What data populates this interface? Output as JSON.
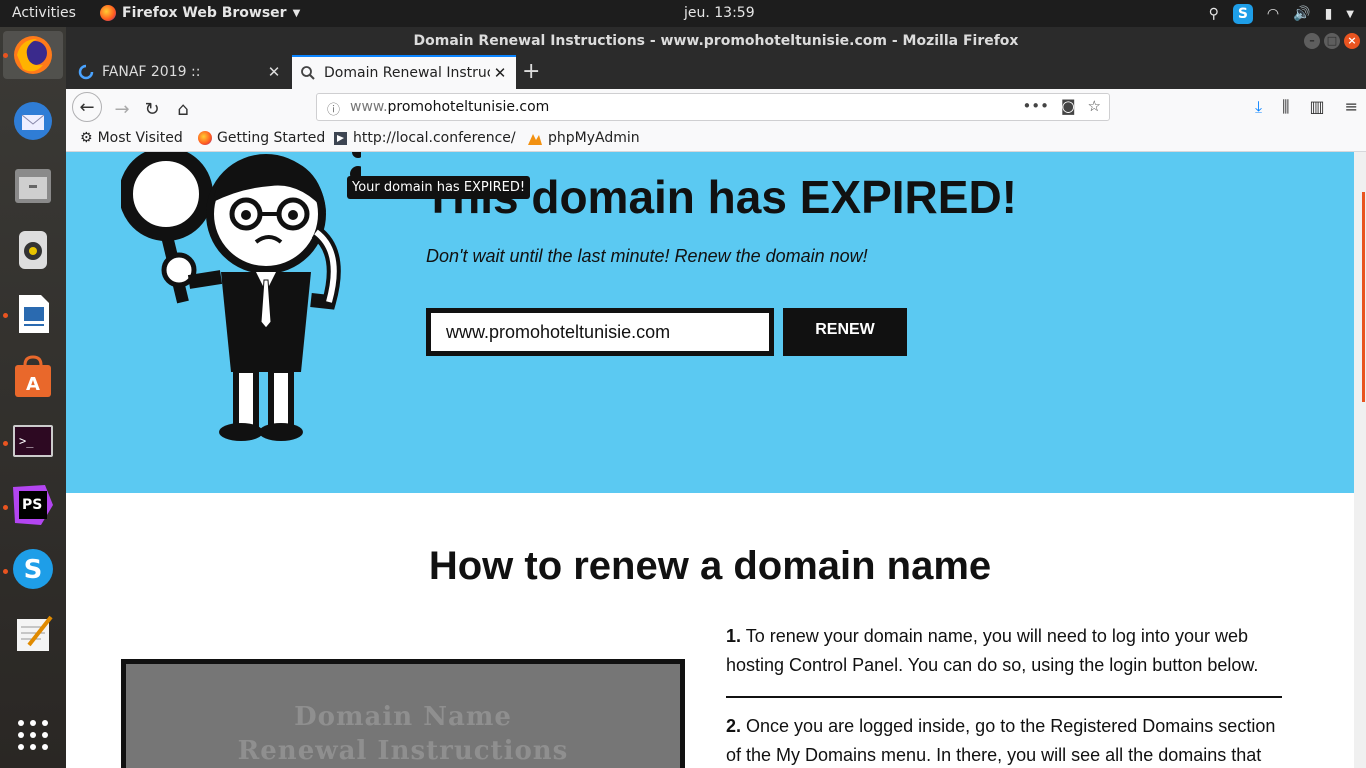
{
  "topbar": {
    "activities": "Activities",
    "app_name": "Firefox Web Browser",
    "clock": "jeu. 13:59"
  },
  "window": {
    "title": "Domain Renewal Instructions - www.promohoteltunisie.com - Mozilla Firefox"
  },
  "tabs": [
    {
      "label": "FANAF 2019 ::"
    },
    {
      "label": "Domain Renewal Instruct"
    }
  ],
  "urlbar": {
    "prefix": "www.",
    "domain": "promohoteltunisie.com"
  },
  "bookmarks": [
    {
      "label": "Most Visited",
      "icon": "gear-icon"
    },
    {
      "label": "Getting Started",
      "icon": "firefox-icon"
    },
    {
      "label": "http://local.conference/",
      "icon": "page-icon"
    },
    {
      "label": "phpMyAdmin",
      "icon": "phpmyadmin-icon"
    }
  ],
  "hero": {
    "title": "This domain has EXPIRED!",
    "tooltip": "Your domain has EXPIRED!",
    "subtitle": "Don't wait until the last minute! Renew the domain now!",
    "domain_value": "www.promohoteltunisie.com",
    "renew_label": "RENEW",
    "bg_color": "#5bc9f2"
  },
  "howto": {
    "heading": "How to renew a domain name",
    "video_line1": "Domain Name",
    "video_line2": "Renewal Instructions",
    "steps": [
      {
        "num": "1.",
        "text": "To renew your domain name, you will need to log into your web hosting Control Panel. You can do so, using the login button below."
      },
      {
        "num": "2.",
        "text": "Once you are logged inside, go to the Registered Domains section of the My Domains menu. In there, you will see all the domains that"
      }
    ]
  },
  "dock": [
    {
      "name": "firefox-icon"
    },
    {
      "name": "thunderbird-icon"
    },
    {
      "name": "files-icon"
    },
    {
      "name": "rhythmbox-icon"
    },
    {
      "name": "writer-icon"
    },
    {
      "name": "software-icon"
    },
    {
      "name": "terminal-icon"
    },
    {
      "name": "phpstorm-icon"
    },
    {
      "name": "skype-icon"
    },
    {
      "name": "text-editor-icon"
    },
    {
      "name": "show-apps-icon"
    }
  ]
}
